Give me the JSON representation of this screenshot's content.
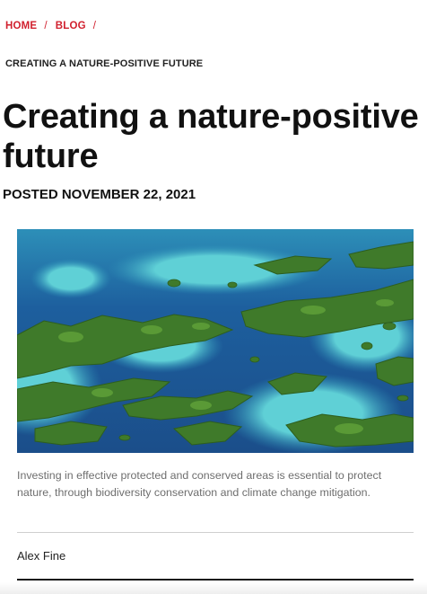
{
  "breadcrumb": {
    "items": [
      "HOME",
      "BLOG"
    ],
    "separator": "/",
    "current": "CREATING A NATURE-POSITIVE FUTURE"
  },
  "article": {
    "title": "Creating a nature-positive future",
    "posted": "POSTED NOVEMBER 22, 2021",
    "caption": "Investing in effective protected and conserved areas is essential to protect nature, through biodiversity conservation and climate change mitigation.",
    "author": "Alex Fine"
  },
  "colors": {
    "accent": "#d1202e",
    "ocean_deep": "#1d4f8c",
    "ocean_shallow": "#38b8c9",
    "island": "#3f7a2a"
  }
}
